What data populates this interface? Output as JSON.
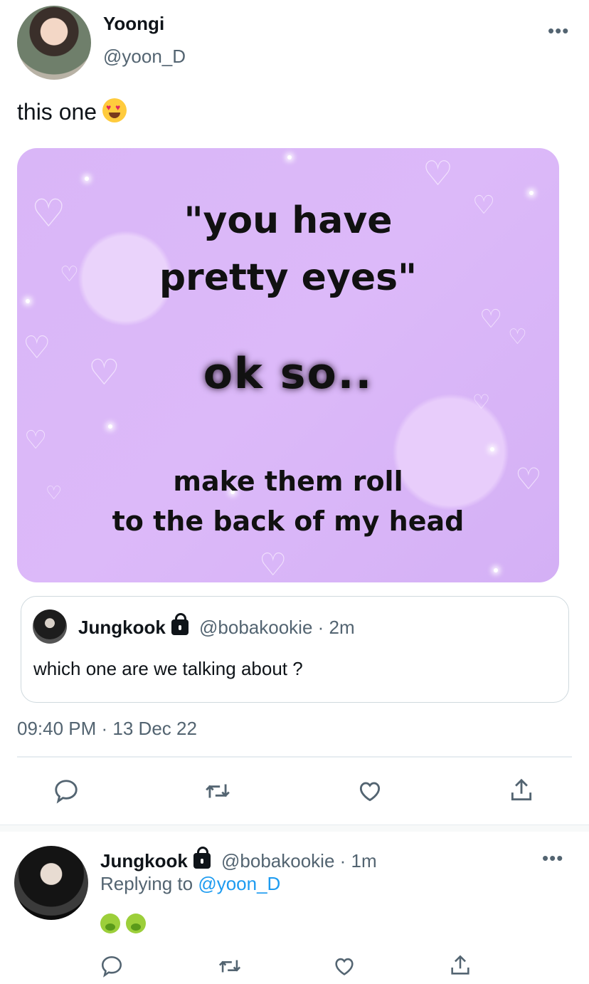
{
  "tweet": {
    "author_name": "Yoongi",
    "author_handle": "@yoon_D",
    "more_label": "•••",
    "text": "this one",
    "text_emoji": "smiling-face-with-heart-eyes",
    "image": {
      "line1": "\"you have",
      "line2": "pretty eyes\"",
      "line3": "ok so..",
      "line4": "make them roll",
      "line5": "to the back of my head"
    },
    "quote": {
      "author_name": "Jungkook",
      "author_handle": "@bobakookie · 2m",
      "text": "which one are we talking about ?"
    },
    "timestamp": "09:40 PM · 13 Dec 22"
  },
  "reply": {
    "author_name": "Jungkook",
    "author_handle": "@bobakookie · 1m",
    "more_label": "•••",
    "replying_prefix": "Replying to",
    "replying_handle": "@yoon_D",
    "emoji": [
      "nauseated-face",
      "nauseated-face"
    ]
  },
  "colors": {
    "text": "#0f1419",
    "secondary": "#536471",
    "link": "#1d9bf0",
    "meme_bg": "#dcb9f9"
  }
}
